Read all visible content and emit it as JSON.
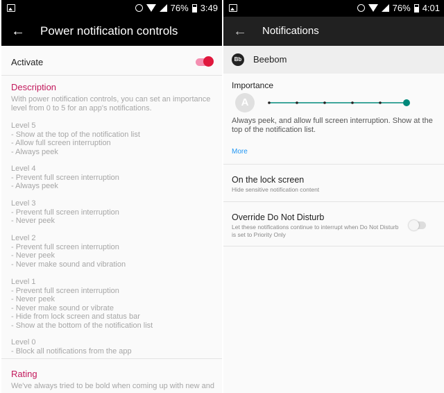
{
  "status_left": {
    "battery": "76%",
    "time": "3:49"
  },
  "status_right": {
    "battery": "76%",
    "time": "4:01"
  },
  "left": {
    "title": "Power notification controls",
    "activate_label": "Activate",
    "description_heading": "Description",
    "description_text": [
      "With power notification controls, you can set an importance",
      "level from 0 to 5 for an app's notifications."
    ],
    "levels": [
      {
        "name": "Level 5",
        "lines": [
          "- Show at the top of the notification list",
          "- Allow full screen interruption",
          "- Always peek"
        ]
      },
      {
        "name": "Level 4",
        "lines": [
          "- Prevent full screen interruption",
          "- Always peek"
        ]
      },
      {
        "name": "Level 3",
        "lines": [
          "- Prevent full screen interruption",
          "- Never peek"
        ]
      },
      {
        "name": "Level 2",
        "lines": [
          "- Prevent full screen interruption",
          "- Never peek",
          "- Never make sound and vibration"
        ]
      },
      {
        "name": "Level 1",
        "lines": [
          "- Prevent full screen interruption",
          "- Never peek",
          "- Never make sound or vibrate",
          "- Hide from lock screen and status bar",
          "- Show at the bottom of the notification list"
        ]
      },
      {
        "name": "Level 0",
        "lines": [
          "- Block all notifications from the app"
        ]
      }
    ],
    "rating_heading": "Rating",
    "rating_text": "We've always tried to be bold when coming up with new and"
  },
  "right": {
    "title": "Notifications",
    "app_name": "Beebom",
    "app_icon_text": "Bb",
    "importance_label": "Importance",
    "importance_badge": "A",
    "importance_level": 5,
    "importance_max": 5,
    "importance_desc": [
      "Always peek, and allow full screen interruption. Show at the",
      "top of the notification list."
    ],
    "more_label": "More",
    "lock_title": "On the lock screen",
    "lock_sub": "Hide sensitive notification content",
    "dnd_title": "Override Do Not Disturb",
    "dnd_sub": [
      "Let these notifications continue to interrupt when Do Not Disturb",
      "is set to Priority Only"
    ]
  },
  "colors": {
    "accent_pink": "#e0183d",
    "teal": "#00897b",
    "link_blue": "#2196f3"
  }
}
